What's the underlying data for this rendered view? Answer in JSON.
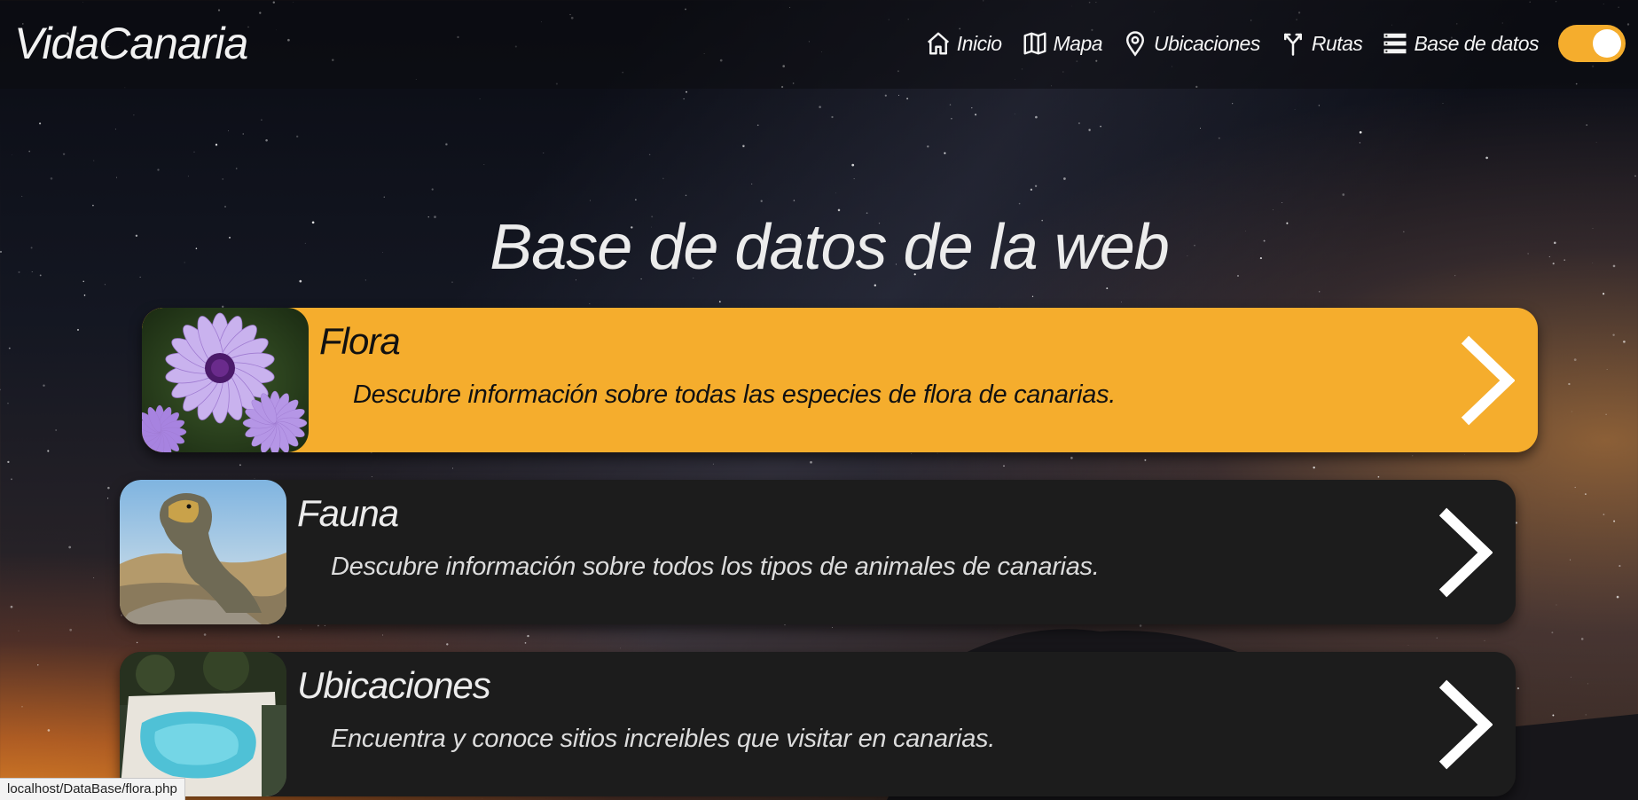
{
  "header": {
    "brand": "VidaCanaria",
    "nav": [
      {
        "label": "Inicio",
        "icon": "home-icon"
      },
      {
        "label": "Mapa",
        "icon": "map-icon"
      },
      {
        "label": "Ubicaciones",
        "icon": "location-pin-icon"
      },
      {
        "label": "Rutas",
        "icon": "route-split-icon"
      },
      {
        "label": "Base de datos",
        "icon": "database-list-icon"
      }
    ],
    "theme_toggle": {
      "state": "on",
      "color": "#f5ad2d"
    }
  },
  "main": {
    "title": "Base de datos de la web",
    "cards": [
      {
        "title": "Flora",
        "description": "Descubre información sobre todas las especies de flora de canarias.",
        "image": "purple-flower-image",
        "style": "highlighted",
        "arrow": "chevron-right-icon"
      },
      {
        "title": "Fauna",
        "description": "Descubre información sobre todos los tipos de animales de canarias.",
        "image": "lizard-image",
        "style": "dark",
        "arrow": "chevron-right-icon"
      },
      {
        "title": "Ubicaciones",
        "description": "Encuentra y conoce sitios increibles que visitar en canarias.",
        "image": "pool-image",
        "style": "dark",
        "arrow": "chevron-right-icon"
      }
    ]
  },
  "status_bar": {
    "url": "localhost/DataBase/flora.php"
  },
  "colors": {
    "accent": "#f5ad2d",
    "card_dark": "#1c1c1c"
  }
}
